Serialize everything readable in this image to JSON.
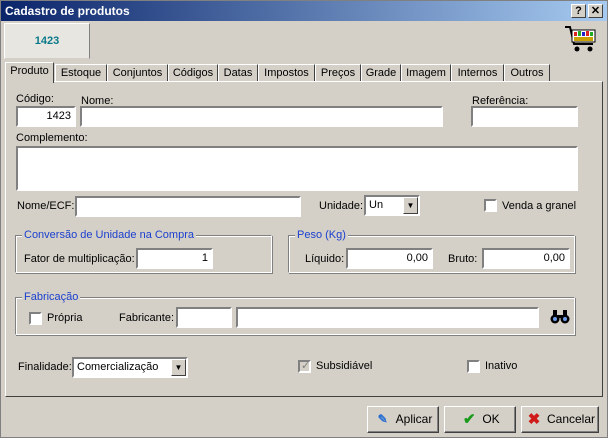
{
  "window": {
    "title": "Cadastro de produtos",
    "help_label": "?",
    "close_label": "✕"
  },
  "header": {
    "product_code": "1423",
    "cart_icon": "shopping-cart-icon"
  },
  "tabs": [
    {
      "label": "Produto",
      "active": true
    },
    {
      "label": "Estoque"
    },
    {
      "label": "Conjuntos"
    },
    {
      "label": "Códigos"
    },
    {
      "label": "Datas"
    },
    {
      "label": "Impostos"
    },
    {
      "label": "Preços"
    },
    {
      "label": "Grade"
    },
    {
      "label": "Imagem"
    },
    {
      "label": "Internos"
    },
    {
      "label": "Outros"
    }
  ],
  "form": {
    "codigo_label": "Código:",
    "codigo_value": "1423",
    "nome_label": "Nome:",
    "nome_value": "",
    "referencia_label": "Referência:",
    "referencia_value": "",
    "complemento_label": "Complemento:",
    "complemento_value": "",
    "nome_ecf_label": "Nome/ECF:",
    "nome_ecf_value": "",
    "unidade_label": "Unidade:",
    "unidade_value": "Un",
    "venda_granel_label": "Venda a granel",
    "venda_granel_checked": false,
    "conversao_title": "Conversão de Unidade na Compra",
    "fator_label": "Fator de multiplicação:",
    "fator_value": "1",
    "peso_title": "Peso (Kg)",
    "liquido_label": "Líquido:",
    "liquido_value": "0,00",
    "bruto_label": "Bruto:",
    "bruto_value": "0,00",
    "fabricacao_title": "Fabricação",
    "propria_label": "Própria",
    "propria_checked": false,
    "fabricante_label": "Fabricante:",
    "fabricante_code": "",
    "fabricante_name": "",
    "finalidade_label": "Finalidade:",
    "finalidade_value": "Comercialização",
    "subsidiavel_label": "Subsidiável",
    "subsidiavel_checked": true,
    "inativo_label": "Inativo",
    "inativo_checked": false
  },
  "buttons": {
    "apply": "Aplicar",
    "ok": "OK",
    "cancel": "Cancelar"
  }
}
